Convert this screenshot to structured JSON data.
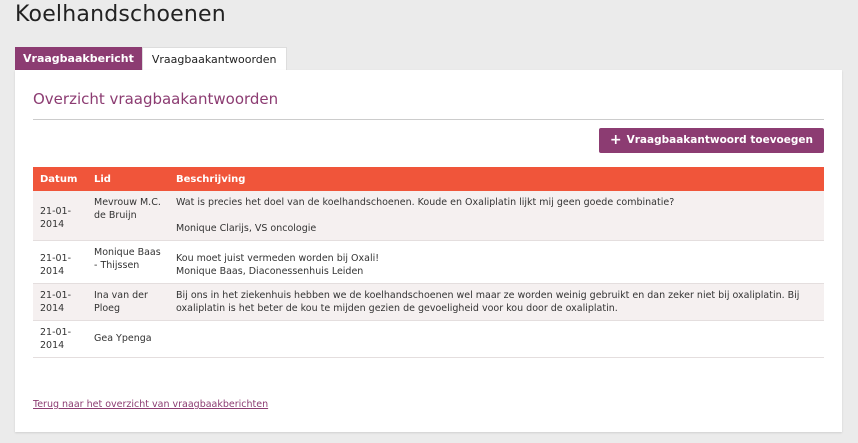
{
  "page": {
    "title": "Koelhandschoenen"
  },
  "tabs": [
    {
      "label": "Vraagbaakbericht",
      "active": false
    },
    {
      "label": "Vraagbaakantwoorden",
      "active": true
    }
  ],
  "section": {
    "title": "Overzicht vraagbaakantwoorden"
  },
  "add_button": {
    "label": "Vraagbaakantwoord toevoegen",
    "icon": "plus-icon"
  },
  "table": {
    "headers": [
      "Datum",
      "Lid",
      "Beschrijving"
    ],
    "rows": [
      {
        "date": "21-01-2014",
        "member": "Mevrouw M.C. de Bruijn",
        "text1": "Wat is precies het doel van de koelhandschoenen. Koude en Oxaliplatin lijkt mij geen goede combinatie?",
        "text2": "Monique Clarijs, VS oncologie"
      },
      {
        "date": "21-01-2014",
        "member": "Monique Baas - Thijssen",
        "text1": "Kou moet juist vermeden worden bij Oxali!",
        "text2": "Monique Baas, Diaconessenhuis Leiden"
      },
      {
        "date": "21-01-2014",
        "member": "Ina van der Ploeg",
        "text1": "Bij ons in het ziekenhuis hebben we de koelhandschoenen wel maar ze worden weinig gebruikt en dan zeker niet bij oxaliplatin. Bij oxaliplatin is het beter de kou te mijden gezien de gevoeligheid voor kou door de oxaliplatin.",
        "text2": ""
      },
      {
        "date": "21-01-2014",
        "member": "Gea Ypenga",
        "text1": "",
        "text2": ""
      }
    ]
  },
  "back_link": {
    "label": "Terug naar het overzicht van vraagbaakberichten"
  },
  "colors": {
    "brand": "#8c3c72",
    "table_header": "#f0553a"
  }
}
